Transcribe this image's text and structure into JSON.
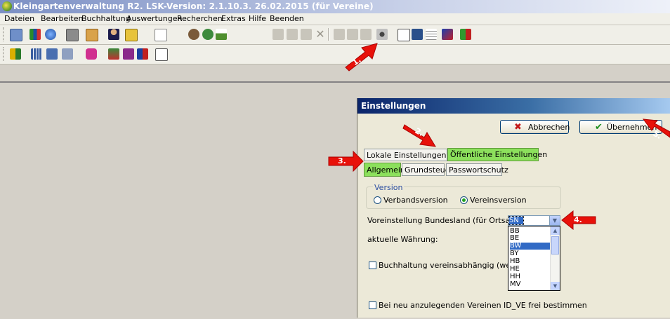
{
  "window": {
    "title": "Kleingartenverwaltung R2.  LSK-Version: 2.1.10.3.   26.02.2015 (für Vereine)"
  },
  "menu": [
    "Dateien",
    "Bearbeiten",
    "Buchhaltung",
    "Auswertungen",
    "Recherchen",
    "Extras",
    "Hilfe",
    "Beenden"
  ],
  "dialog": {
    "title": "Einstellungen",
    "cancel_label": "Abbrechen",
    "apply_label": "Übernehmen",
    "tabs": [
      "Lokale Einstellungen",
      "Öffentliche Einstellungen"
    ],
    "subtabs": [
      "Allgemein",
      "Grundsteuer",
      "Passwortschutz"
    ],
    "version_group": "Version",
    "radio_verband": "Verbandsversion",
    "radio_verein": "Vereinsversion",
    "bundesland_label": "Voreinstellung Bundesland (für Ortsauswahl):",
    "bundesland_value": "SN",
    "bundesland_options": [
      "BB",
      "BE",
      "BW",
      "BY",
      "HB",
      "HE",
      "HH",
      "MV"
    ],
    "bundesland_highlighted": "BW",
    "waehrung_label": "aktuelle Währung:",
    "buchhaltung_label": "Buchhaltung vereinsabhängig (wenn mehrere",
    "id_ve_label": "Bei neu anzulegenden Vereinen ID_VE frei bestimmen"
  },
  "annotations": [
    "1.",
    "2.",
    "3.",
    "4.",
    "5."
  ],
  "colors": {
    "annotation_red": "#e8110a",
    "tab_highlight": "#8ce05c",
    "title_gradient_start": "#0a246a"
  }
}
